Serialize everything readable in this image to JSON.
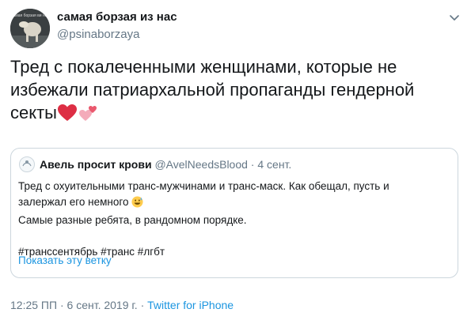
{
  "author": {
    "display_name": "самая борзая из нас",
    "handle": "@psinaborzaya",
    "avatar_caption": "самая борзая ви нас"
  },
  "tweet": {
    "lines": [
      "Тред с покалеченными женщинами, которые не",
      "избежали патриархальной пропаганды гендерной",
      "секты"
    ],
    "emojis": [
      "red-heart",
      "two-hearts"
    ]
  },
  "quoted_tweet": {
    "display_name": "Авель просит крови",
    "handle": "@AvelNeedsBlood",
    "separator": "·",
    "date": "4 сент.",
    "lines": [
      "Тред с охуительными транс-мужчинами и транс-маск. Как обещал, пусть и",
      "залержал его немного",
      "Самые разные ребята, в рандомном порядке.",
      "#транссентябрь #транс #лгбт"
    ],
    "emoji": "grinning-sweat-face",
    "show_thread_label": "Показать эту ветку"
  },
  "meta": {
    "time": "12:25 ПП",
    "separator": "·",
    "date": "6 сент. 2019 г.",
    "source": "Twitter for iPhone"
  },
  "colors": {
    "link": "#1b95e0",
    "secondary_text": "#657786",
    "border": "#ccd6dd",
    "heart": "#e0245e"
  }
}
